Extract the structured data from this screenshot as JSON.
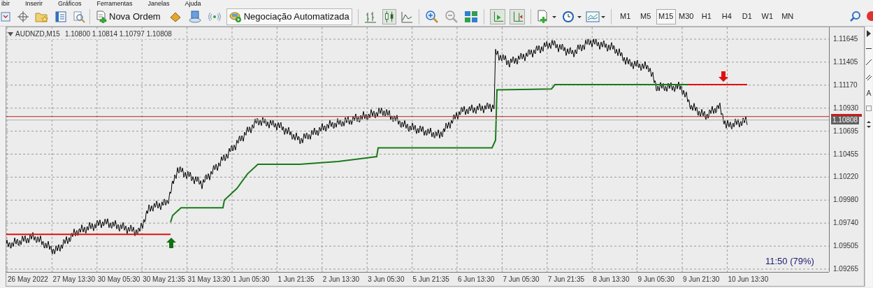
{
  "menu": [
    "ibir",
    "Inserir",
    "Gráficos",
    "Ferramentas",
    "Janelas",
    "Ajuda"
  ],
  "toolbar": {
    "order_button": "Nova Ordem",
    "auto_trading_button": "Negociação Automatizada",
    "timeframes": [
      {
        "label": "M1",
        "selected": false
      },
      {
        "label": "M5",
        "selected": false
      },
      {
        "label": "M15",
        "selected": true
      },
      {
        "label": "M30",
        "selected": false
      },
      {
        "label": "H1",
        "selected": false
      },
      {
        "label": "H4",
        "selected": false
      },
      {
        "label": "D1",
        "selected": false
      },
      {
        "label": "W1",
        "selected": false
      },
      {
        "label": "MN",
        "selected": false
      }
    ]
  },
  "chart": {
    "symbol": "AUDNZD,M15",
    "ohlc": "1.10800 1.10814 1.10797 1.10808",
    "price_labels": [
      "1.11645",
      "1.11405",
      "1.11170",
      "1.10930",
      "1.10695",
      "1.10455",
      "1.10220",
      "1.09980",
      "1.09740",
      "1.09505",
      "1.09265"
    ],
    "current_price": "1.10808",
    "time_labels": [
      "26 May 2022",
      "27 May 13:30",
      "30 May 05:30",
      "30 May 21:35",
      "31 May 13:30",
      "1 Jun 05:30",
      "1 Jun 21:35",
      "2 Jun 13:30",
      "3 Jun 05:30",
      "5 Jun 21:35",
      "6 Jun 13:30",
      "7 Jun 05:30",
      "7 Jun 21:35",
      "8 Jun 13:30",
      "9 Jun 05:30",
      "9 Jun 21:30",
      "10 Jun 13:30"
    ],
    "timer": "11:50 (79%)"
  }
}
